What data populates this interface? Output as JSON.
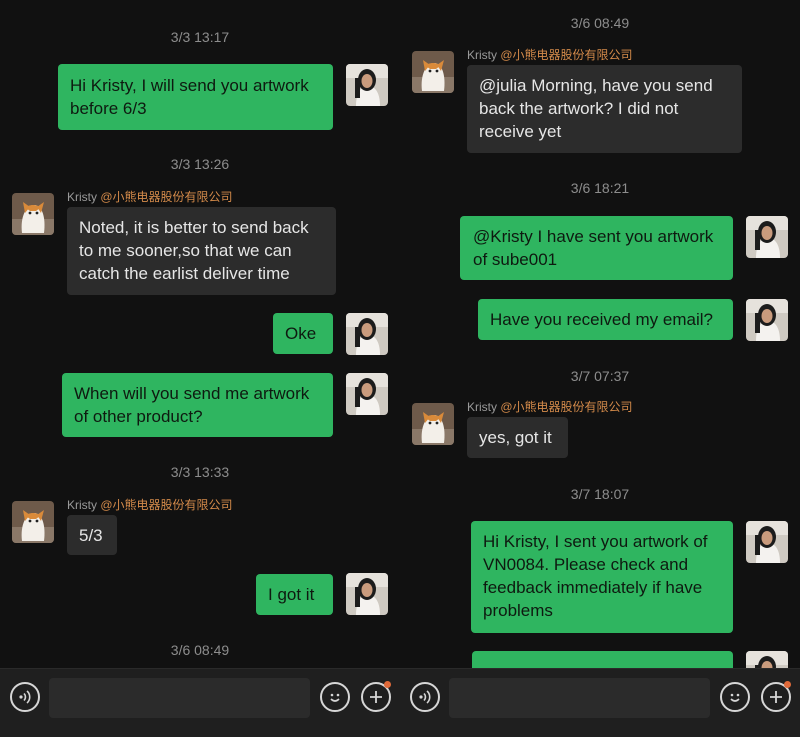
{
  "left": {
    "ts1": "3/3 13:17",
    "msg1_l1": "Hi Kristy, I will send you artwork",
    "msg1_l2": "before 6/3",
    "ts2": "3/3 13:26",
    "kristy_name": "Kristy",
    "kristy_org": "@小熊电器股份有限公司",
    "msg2_l1": "Noted, it is better to send back",
    "msg2_l2": "to me sooner,so that we can",
    "msg2_l3": "catch the earlist deliver time",
    "msg3": "Oke",
    "msg4_l1": "When will you send me artwork",
    "msg4_l2": "of other product?",
    "ts3": "3/3 13:33",
    "msg5": "5/3",
    "msg6": "I got it",
    "ts4": "3/6 08:49"
  },
  "right": {
    "ts1": "3/6 08:49",
    "kristy_name": "Kristy",
    "kristy_org": "@小熊电器股份有限公司",
    "msg1_l1": "@julia Morning,  have you send",
    "msg1_l2": "back the artwork? I did not",
    "msg1_l3": "receive yet",
    "ts2": "3/6 18:21",
    "msg2_l1": "@Kristy I have sent you artwork",
    "msg2_l2": "of sube001",
    "msg3": "Have you received my email?",
    "ts3": "3/7 07:37",
    "msg4": "yes, got it",
    "ts4": "3/7 18:07",
    "msg5_l1": "Hi Kristy, I sent you artwork of",
    "msg5_l2": "VN0084. Please check and",
    "msg5_l3": "feedback immediately if have",
    "msg5_l4": "problems"
  },
  "icons": {
    "voice": "voice-wave-icon",
    "emoji": "smiley-emoji-icon",
    "plus": "plus-circle-icon"
  },
  "colors": {
    "background": "#111111",
    "sent_bubble": "#2fb560",
    "received_bubble": "#2c2c2c",
    "org_tag": "#d38a4a",
    "timestamp": "#8d8d8d"
  }
}
